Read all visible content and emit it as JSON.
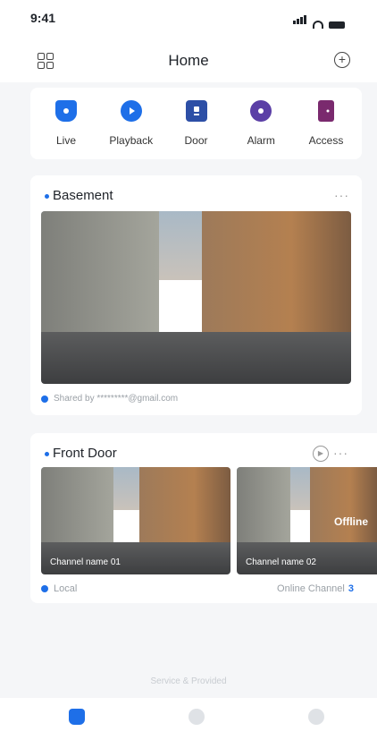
{
  "status": {
    "time": "9:41"
  },
  "nav": {
    "title": "Home"
  },
  "quick_actions": [
    {
      "label": "Live",
      "icon": "camera-icon"
    },
    {
      "label": "Playback",
      "icon": "playback-icon"
    },
    {
      "label": "Door",
      "icon": "door-icon"
    },
    {
      "label": "Alarm",
      "icon": "alarm-icon"
    },
    {
      "label": "Access",
      "icon": "access-icon"
    }
  ],
  "basement": {
    "title": "Basement",
    "shared": "Shared by *********@gmail.com"
  },
  "front_door": {
    "title": "Front Door",
    "channels": [
      {
        "name": "Channel name 01"
      },
      {
        "name": "Channel name 02",
        "status": "Offline"
      }
    ],
    "source": "Local",
    "online_label": "Online Channel",
    "online_count": "3"
  },
  "footer": {
    "service": "Service & Provided"
  },
  "colors": {
    "accent": "#1e6fe8"
  }
}
